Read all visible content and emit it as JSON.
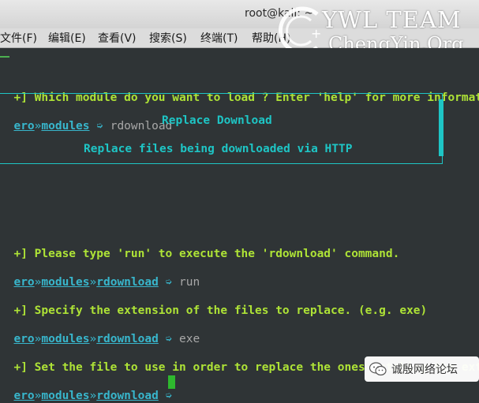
{
  "window": {
    "title": "root@kali: ~"
  },
  "menu": [
    {
      "label": "文件(F)"
    },
    {
      "label": "编辑(E)"
    },
    {
      "label": "查看(V)"
    },
    {
      "label": "搜索(S)"
    },
    {
      "label": "终端(T)"
    },
    {
      "label": "帮助(H)"
    }
  ],
  "watermark": {
    "line1": "YWL TEAM",
    "line2": "ChengYin.Org"
  },
  "terminal": {
    "lines": [
      {
        "type": "info",
        "text": "+] Which module do you want to load ? Enter 'help' for more informat"
      },
      {
        "type": "prompt",
        "segments": [
          "ero",
          "modules"
        ],
        "command": "rdownload"
      },
      {
        "type": "info",
        "text": "+] Please type 'run' to execute the 'rdownload' command."
      },
      {
        "type": "prompt",
        "segments": [
          "ero",
          "modules",
          "rdownload"
        ],
        "command": "run"
      },
      {
        "type": "info",
        "text": "+] Specify the extension of the files to replace. (e.g. exe)"
      },
      {
        "type": "prompt",
        "segments": [
          "ero",
          "modules",
          "rdownload"
        ],
        "command": "exe"
      },
      {
        "type": "info",
        "text": "+] Set the file to use in order to replace the ones matching the ext"
      },
      {
        "type": "prompt",
        "segments": [
          "ero",
          "modules",
          "rdownload"
        ],
        "command": ""
      }
    ],
    "banner": {
      "title": "Replace Download",
      "subtitle": "Replace files being downloaded via HTTP"
    },
    "separator": "»",
    "prompt_arrow": "➭"
  },
  "badge": {
    "text": "诚殷网络论坛",
    "icon": "wechat-icon"
  },
  "colors": {
    "background": "#2f3436",
    "info_text": "#aee336",
    "prompt_text": "#38b6cc",
    "banner": "#1ec5c5",
    "cursor": "#2eb82e"
  }
}
